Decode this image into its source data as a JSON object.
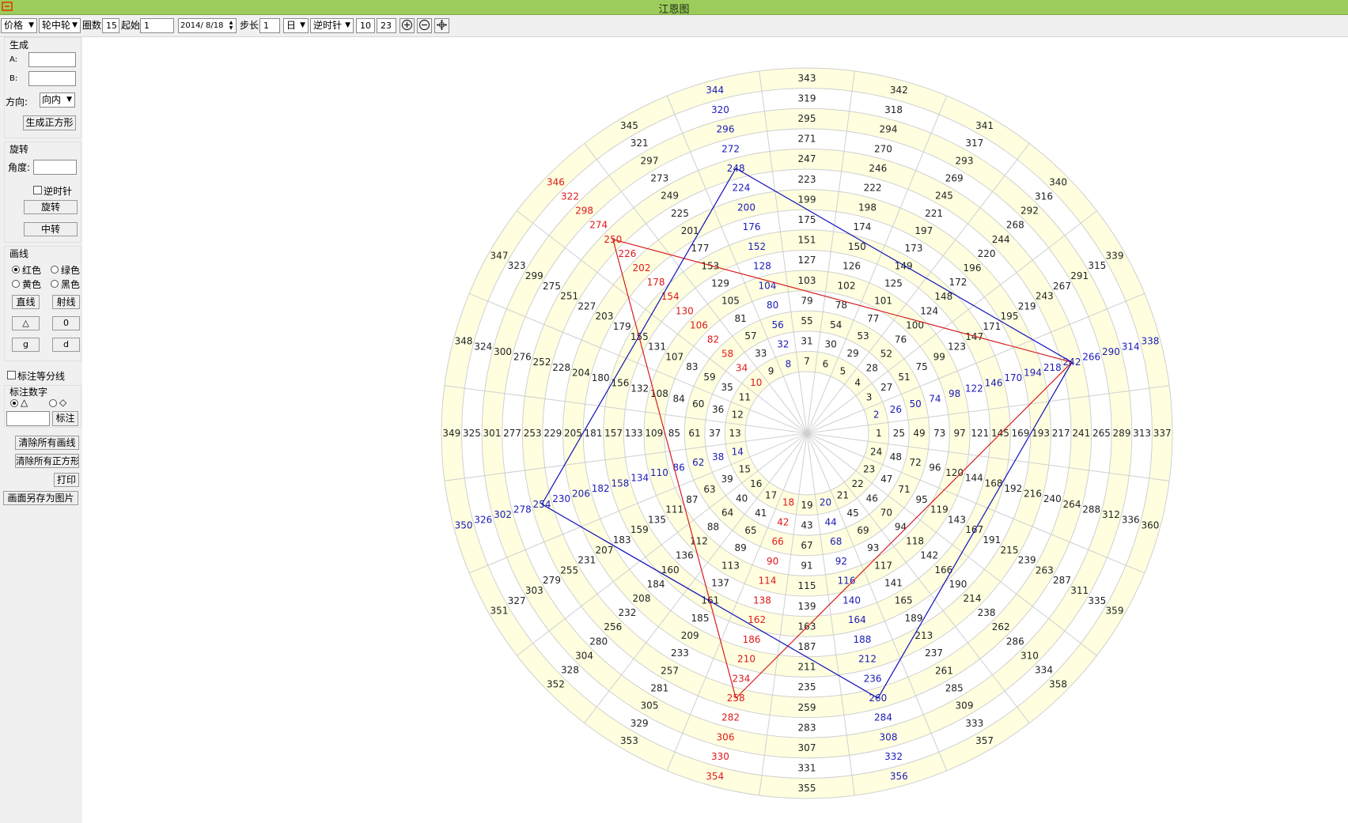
{
  "window": {
    "title": "江恩图"
  },
  "colors": {
    "title_bar": "#9ccc5b",
    "ring_fill": "#ffffe0",
    "black_num": "#222222",
    "red_num": "#e01818",
    "blue_num": "#1a1ab8",
    "red_line": "#d41c1c",
    "blue_line": "#1010b8"
  },
  "toolbar": {
    "type_select": "价格",
    "mode_select": "轮中轮",
    "circles_label": "圈数",
    "circles_value": "15",
    "start_label": "起始",
    "start_value": "1",
    "date_value": "2014/ 8/18",
    "step_label": "步长",
    "step_value": "1",
    "unit_select": "日",
    "direction_select": "逆时针",
    "num1": "10",
    "num2": "23",
    "zoom_in_icon": "plus-circle",
    "zoom_out_icon": "minus-circle",
    "move_icon": "move-cross"
  },
  "sidebar": {
    "generate": {
      "heading": "生成",
      "a_label": "A:",
      "a_value": "",
      "b_label": "B:",
      "b_value": "",
      "direction_label": "方向:",
      "direction_value": "向内",
      "button": "生成正方形"
    },
    "rotate": {
      "heading": "旋转",
      "angle_label": "角度:",
      "angle_value": "",
      "ccw_label": "逆时针",
      "ccw_checked": false,
      "rotate_button": "旋转",
      "center_button": "中转"
    },
    "draw": {
      "heading": "画线",
      "red": "红色",
      "green": "绿色",
      "yellow": "黄色",
      "black": "黑色",
      "selected_color": "红色",
      "line_button": "直线",
      "ray_button": "射线",
      "triangle_button": "△",
      "zero_button": "0",
      "g_button": "g",
      "d_button": "d"
    },
    "mark_equal_label": "标注等分线",
    "mark_equal_checked": false,
    "mark_num": {
      "heading": "标注数字",
      "triangle": "△",
      "diamond": "◇",
      "selected": "△",
      "value": "",
      "button": "标注"
    },
    "clear_lines": "清除所有画线",
    "clear_squares": "清除所有正方形",
    "print": "打印",
    "save_image": "画面另存为图片"
  },
  "wheel": {
    "rings": 15,
    "sectors": 24,
    "start": 1,
    "order": "counter-clockwise",
    "red_numbers": [
      10,
      18,
      34,
      42,
      58,
      66,
      82,
      90,
      106,
      114,
      130,
      138,
      154,
      162,
      178,
      186,
      202,
      210,
      226,
      234,
      250,
      258,
      274,
      282,
      298,
      306,
      322,
      330,
      346,
      354
    ],
    "blue_numbers": [
      2,
      8,
      14,
      20,
      26,
      32,
      38,
      44,
      50,
      56,
      62,
      68,
      74,
      80,
      86,
      92,
      98,
      104,
      110,
      116,
      122,
      128,
      134,
      140,
      146,
      152,
      158,
      164,
      170,
      176,
      182,
      188,
      194,
      200,
      206,
      212,
      218,
      224,
      230,
      236,
      242,
      248,
      254,
      260,
      266,
      272,
      278,
      284,
      290,
      296,
      302,
      308,
      314,
      320,
      326,
      332,
      338,
      344,
      350,
      356
    ],
    "red_triangle": [
      250,
      242,
      258
    ],
    "blue_square": [
      248,
      242,
      260,
      254
    ]
  }
}
